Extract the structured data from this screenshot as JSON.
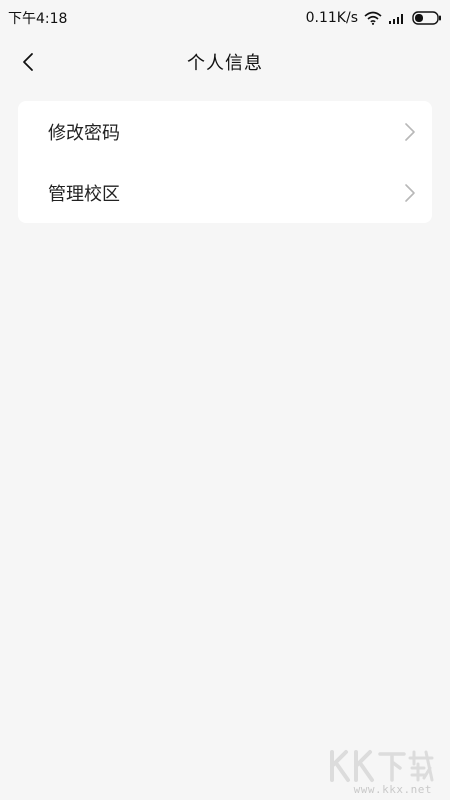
{
  "status_bar": {
    "time": "下午4:18",
    "network_speed": "0.11K/s",
    "icons": [
      "wifi-icon",
      "signal-icon",
      "battery-icon"
    ]
  },
  "header": {
    "title": "个人信息",
    "back_icon": "chevron-left-icon"
  },
  "menu": {
    "items": [
      {
        "label": "修改密码",
        "icon": "chevron-right-icon"
      },
      {
        "label": "管理校区",
        "icon": "chevron-right-icon"
      }
    ]
  },
  "watermark": {
    "logo_text": "KK下载",
    "url": "www.kkx.net"
  },
  "colors": {
    "background": "#f6f6f6",
    "card": "#ffffff",
    "text": "#222222",
    "chevron": "#b8b8b8"
  }
}
